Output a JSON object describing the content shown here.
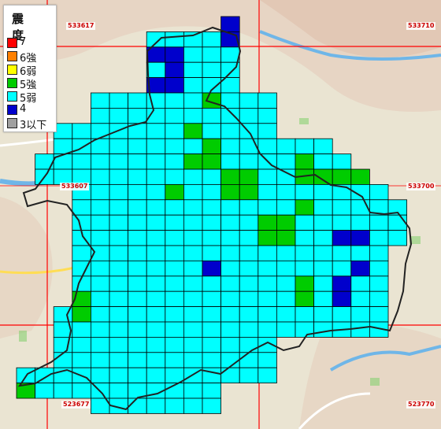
{
  "legend": {
    "title": "震 度",
    "items": [
      {
        "label": "7",
        "color": "#ff0000"
      },
      {
        "label": "6強",
        "color": "#ff8000"
      },
      {
        "label": "6弱",
        "color": "#ffff00"
      },
      {
        "label": "5強",
        "color": "#00cc00"
      },
      {
        "label": "5弱",
        "color": "#00ffff"
      },
      {
        "label": "4",
        "color": "#0000cc"
      },
      {
        "label": "3以下",
        "color": "#a0a0a0"
      }
    ]
  },
  "mesh_codes": [
    "533617",
    "533710",
    "533607",
    "533700",
    "523677",
    "523770"
  ],
  "colors": {
    "cell_5jaku": "#00ffff",
    "cell_5kyo": "#00cc00",
    "cell_4": "#0000cc",
    "grid_line": "#000000",
    "boundary": "#222222",
    "mesh_line": "#ff0000",
    "map_base": "#e9e2cf"
  },
  "grid": {
    "rows": [
      {
        "row": 0,
        "ranges": [
          [
            11,
            11
          ]
        ],
        "kyo": [],
        "four": [
          [
            11,
            11
          ]
        ]
      },
      {
        "row": 1,
        "ranges": [
          [
            7,
            11
          ]
        ],
        "kyo": [],
        "four": [
          [
            11,
            11
          ]
        ]
      },
      {
        "row": 2,
        "ranges": [
          [
            7,
            11
          ]
        ],
        "kyo": [],
        "four": [
          [
            7,
            8
          ]
        ]
      },
      {
        "row": 3,
        "ranges": [
          [
            7,
            11
          ]
        ],
        "kyo": [],
        "four": [
          [
            8,
            8
          ]
        ]
      },
      {
        "row": 4,
        "ranges": [
          [
            7,
            11
          ]
        ],
        "kyo": [],
        "four": [
          [
            7,
            8
          ]
        ]
      },
      {
        "row": 5,
        "ranges": [
          [
            4,
            13
          ]
        ],
        "kyo": [
          [
            10,
            10
          ]
        ],
        "four": []
      },
      {
        "row": 6,
        "ranges": [
          [
            4,
            13
          ]
        ],
        "kyo": [],
        "four": []
      },
      {
        "row": 7,
        "ranges": [
          [
            2,
            13
          ]
        ],
        "kyo": [
          [
            9,
            9
          ]
        ],
        "four": []
      },
      {
        "row": 8,
        "ranges": [
          [
            2,
            16
          ]
        ],
        "kyo": [
          [
            10,
            10
          ]
        ],
        "four": []
      },
      {
        "row": 9,
        "ranges": [
          [
            1,
            17
          ]
        ],
        "kyo": [
          [
            9,
            10
          ],
          [
            15,
            15
          ]
        ],
        "four": []
      },
      {
        "row": 10,
        "ranges": [
          [
            1,
            18
          ]
        ],
        "kyo": [
          [
            11,
            12
          ],
          [
            15,
            16
          ],
          [
            17,
            18
          ]
        ],
        "four": []
      },
      {
        "row": 11,
        "ranges": [
          [
            3,
            19
          ]
        ],
        "kyo": [
          [
            8,
            8
          ],
          [
            11,
            12
          ]
        ],
        "four": []
      },
      {
        "row": 12,
        "ranges": [
          [
            3,
            20
          ]
        ],
        "kyo": [
          [
            15,
            15
          ]
        ],
        "four": []
      },
      {
        "row": 13,
        "ranges": [
          [
            3,
            20
          ]
        ],
        "kyo": [
          [
            13,
            14
          ]
        ],
        "four": []
      },
      {
        "row": 14,
        "ranges": [
          [
            3,
            20
          ]
        ],
        "kyo": [
          [
            13,
            14
          ]
        ],
        "four": [
          [
            17,
            18
          ]
        ]
      },
      {
        "row": 15,
        "ranges": [
          [
            3,
            19
          ]
        ],
        "kyo": [],
        "four": []
      },
      {
        "row": 16,
        "ranges": [
          [
            3,
            19
          ]
        ],
        "kyo": [],
        "four": [
          [
            10,
            10
          ],
          [
            18,
            18
          ]
        ]
      },
      {
        "row": 17,
        "ranges": [
          [
            3,
            19
          ]
        ],
        "kyo": [
          [
            15,
            15
          ]
        ],
        "four": [
          [
            17,
            17
          ]
        ]
      },
      {
        "row": 18,
        "ranges": [
          [
            3,
            19
          ]
        ],
        "kyo": [
          [
            3,
            3
          ],
          [
            15,
            15
          ]
        ],
        "four": [
          [
            17,
            17
          ]
        ]
      },
      {
        "row": 19,
        "ranges": [
          [
            2,
            19
          ]
        ],
        "kyo": [
          [
            3,
            3
          ]
        ],
        "four": []
      },
      {
        "row": 20,
        "ranges": [
          [
            2,
            19
          ]
        ],
        "kyo": [],
        "four": []
      },
      {
        "row": 21,
        "ranges": [
          [
            2,
            13
          ]
        ],
        "kyo": [],
        "four": []
      },
      {
        "row": 22,
        "ranges": [
          [
            2,
            13
          ]
        ],
        "kyo": [],
        "four": []
      },
      {
        "row": 23,
        "ranges": [
          [
            0,
            13
          ]
        ],
        "kyo": [],
        "four": []
      },
      {
        "row": 24,
        "ranges": [
          [
            0,
            10
          ]
        ],
        "kyo": [
          [
            0,
            0
          ]
        ],
        "four": []
      },
      {
        "row": 25,
        "ranges": [
          [
            4,
            10
          ]
        ],
        "kyo": [],
        "four": []
      }
    ]
  }
}
